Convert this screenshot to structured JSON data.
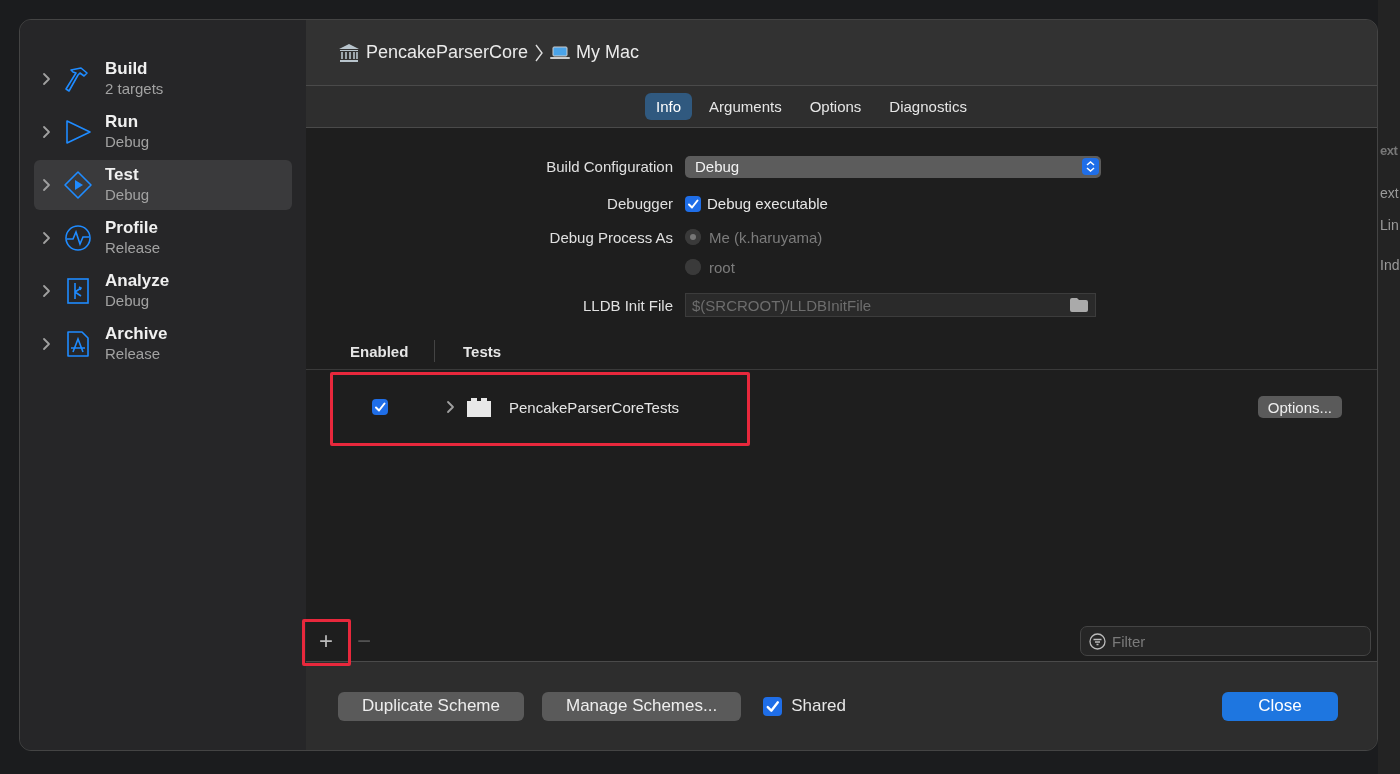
{
  "background_editor": {
    "fragments": [
      {
        "text": "ext",
        "kind": "heading"
      },
      {
        "text": "ext",
        "kind": "text"
      },
      {
        "text": "Lin",
        "kind": "text"
      },
      {
        "text": "Ind",
        "kind": "text"
      }
    ]
  },
  "scheme_actions": [
    {
      "name": "Build",
      "detail": "2 targets",
      "kind": "build",
      "selected": false
    },
    {
      "name": "Run",
      "detail": "Debug",
      "kind": "run",
      "selected": false
    },
    {
      "name": "Test",
      "detail": "Debug",
      "kind": "test",
      "selected": true
    },
    {
      "name": "Profile",
      "detail": "Release",
      "kind": "profile",
      "selected": false
    },
    {
      "name": "Analyze",
      "detail": "Debug",
      "kind": "analyze",
      "selected": false
    },
    {
      "name": "Archive",
      "detail": "Release",
      "kind": "archive",
      "selected": false
    }
  ],
  "breadcrumb": {
    "project": "PencakeParserCore",
    "destination": "My Mac"
  },
  "tabs": [
    {
      "label": "Info",
      "selected": true
    },
    {
      "label": "Arguments",
      "selected": false
    },
    {
      "label": "Options",
      "selected": false
    },
    {
      "label": "Diagnostics",
      "selected": false
    }
  ],
  "form": {
    "build_configuration": {
      "label": "Build Configuration",
      "value": "Debug"
    },
    "debugger": {
      "label": "Debugger",
      "option": "Debug executable",
      "checked": true
    },
    "debug_process_as": {
      "label": "Debug Process As",
      "disabled": true,
      "options": [
        {
          "label": "Me (k.haruyama)",
          "selected": true
        },
        {
          "label": "root",
          "selected": false
        }
      ]
    },
    "lldb_init_file": {
      "label": "LLDB Init File",
      "placeholder": "$(SRCROOT)/LLDBInitFile"
    }
  },
  "tests_table": {
    "columns": [
      "Enabled",
      "Tests"
    ],
    "rows": [
      {
        "enabled": true,
        "expanded": false,
        "name": "PencakeParserCoreTests",
        "options_button": "Options..."
      }
    ]
  },
  "list_controls": {
    "add": "+",
    "remove": "−",
    "remove_disabled": true,
    "filter_placeholder": "Filter"
  },
  "footer": {
    "duplicate": "Duplicate Scheme",
    "manage": "Manage Schemes...",
    "shared": {
      "label": "Shared",
      "checked": true
    },
    "close": "Close"
  },
  "annotations": [
    {
      "kind": "highlight"
    },
    {
      "kind": "highlight"
    }
  ]
}
